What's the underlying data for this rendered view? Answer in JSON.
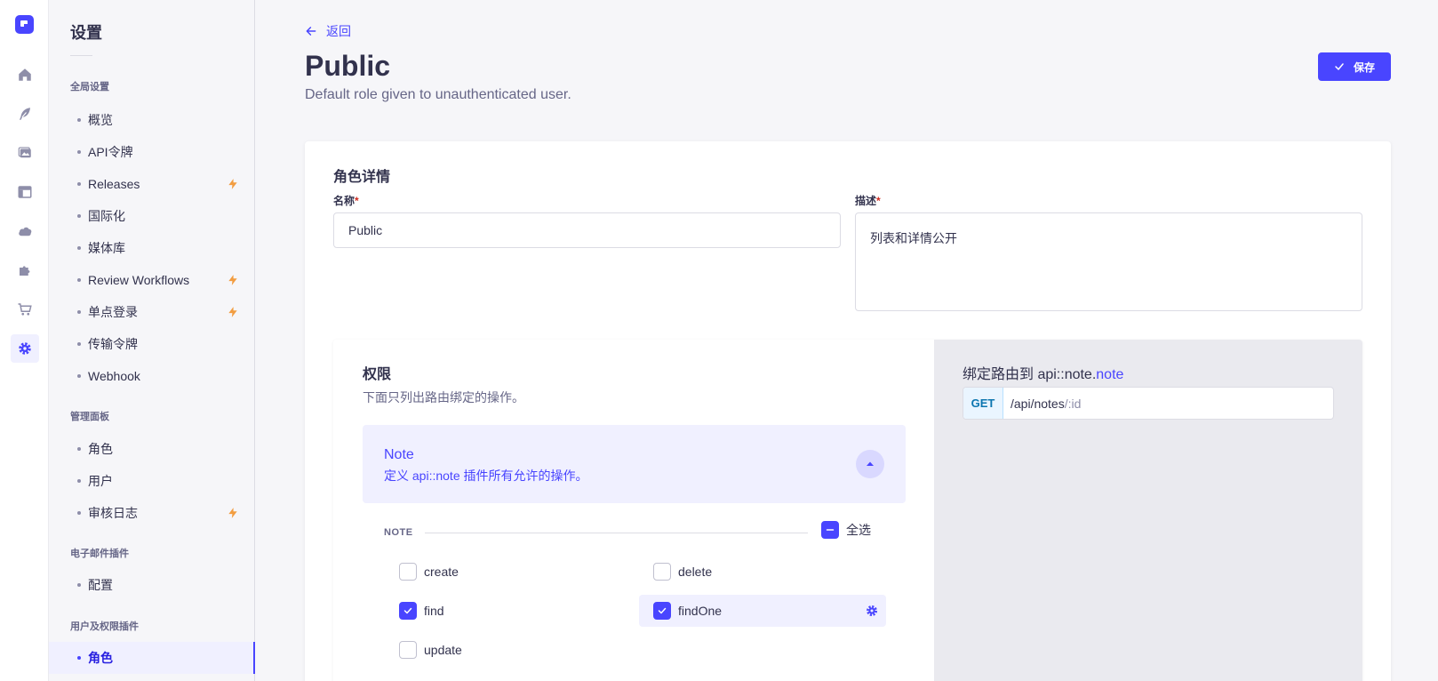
{
  "sidebar": {
    "title": "设置",
    "sections": [
      {
        "label": "全局设置",
        "items": [
          {
            "label": "概览",
            "badge": false
          },
          {
            "label": "API令牌",
            "badge": false
          },
          {
            "label": "Releases",
            "badge": true
          },
          {
            "label": "国际化",
            "badge": false
          },
          {
            "label": "媒体库",
            "badge": false
          },
          {
            "label": "Review Workflows",
            "badge": true
          },
          {
            "label": "单点登录",
            "badge": true
          },
          {
            "label": "传输令牌",
            "badge": false
          },
          {
            "label": "Webhook",
            "badge": false
          }
        ]
      },
      {
        "label": "管理面板",
        "items": [
          {
            "label": "角色",
            "badge": false
          },
          {
            "label": "用户",
            "badge": false
          },
          {
            "label": "审核日志",
            "badge": true
          }
        ]
      },
      {
        "label": "电子邮件插件",
        "items": [
          {
            "label": "配置",
            "badge": false
          }
        ]
      },
      {
        "label": "用户及权限插件",
        "items": [
          {
            "label": "角色",
            "badge": false,
            "active": true
          }
        ]
      }
    ]
  },
  "rail": {
    "icons": [
      "home-icon",
      "feather-icon",
      "images-icon",
      "layout-icon",
      "cloud-icon",
      "puzzle-icon",
      "cart-icon",
      "cog-icon"
    ],
    "active": "cog-icon"
  },
  "header": {
    "back_label": "返回",
    "title": "Public",
    "subtitle": "Default role given to unauthenticated user.",
    "save_label": "保存"
  },
  "role_details": {
    "title": "角色详情",
    "name_label": "名称",
    "name_value": "Public",
    "description_label": "描述",
    "description_value": "列表和详情公开",
    "required_mark": "*"
  },
  "permissions": {
    "title": "权限",
    "subtitle": "下面只列出路由绑定的操作。",
    "plugin": {
      "name": "Note",
      "description": "定义 api::note 插件所有允许的操作。"
    },
    "group_label": "NOTE",
    "select_all_label": "全选",
    "actions": [
      {
        "name": "create",
        "checked": false
      },
      {
        "name": "delete",
        "checked": false
      },
      {
        "name": "find",
        "checked": true
      },
      {
        "name": "findOne",
        "checked": true,
        "highlighted": true
      },
      {
        "name": "update",
        "checked": false
      }
    ]
  },
  "bound_route": {
    "title_prefix": "绑定路由到 api::note.",
    "title_accent": "note",
    "method": "GET",
    "path": "/api/notes",
    "param": "/:id"
  },
  "colors": {
    "primary": "#4945ff",
    "bolt": "#f29d41"
  }
}
